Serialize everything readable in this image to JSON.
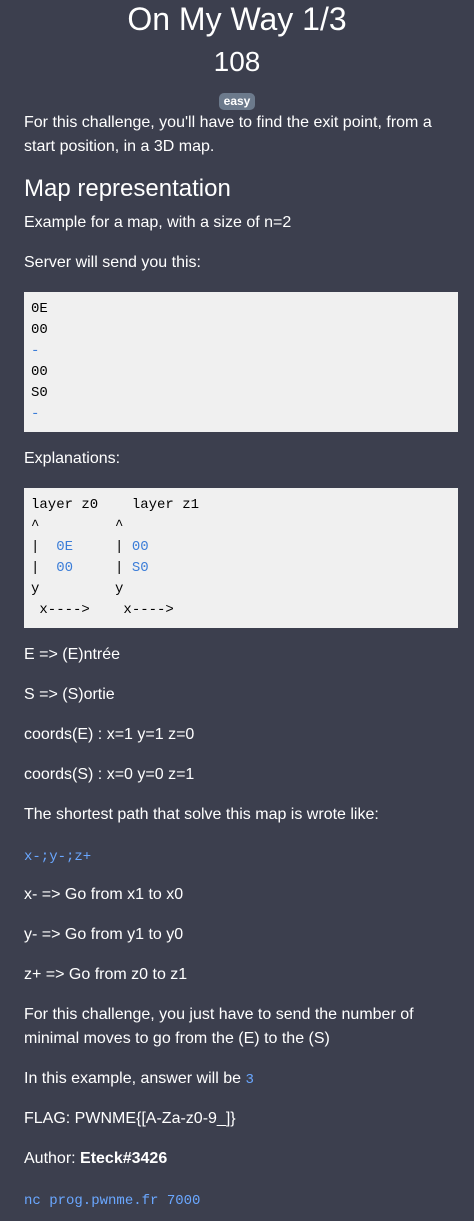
{
  "challenge": {
    "title": "On My Way 1/3",
    "points": "108",
    "difficulty": "easy"
  },
  "content": {
    "intro": "For this challenge, you'll have to find the exit point, from a start position, in a 3D map.",
    "heading": "Map representation",
    "example_line": "Example for a map, with a size of n=2",
    "server_line": "Server will send you this:",
    "server_block": [
      "0E",
      "00",
      "-",
      "00",
      "S0",
      "-"
    ],
    "explanations_label": "Explanations:",
    "explanation_block": {
      "header": "layer z0    layer z1",
      "arrows": "^         ^",
      "row1_a": "|  ",
      "row1_b": "0E",
      "row1_c": "     | ",
      "row1_d": "00",
      "row2_a": "|  ",
      "row2_b": "00",
      "row2_c": "     | ",
      "row2_d": "S0",
      "yline": "y         y",
      "xline": " x---->    x---->"
    },
    "e_def": "E => (E)ntrée",
    "s_def": "S => (S)ortie",
    "coords_e": "coords(E) : x=1 y=1 z=0",
    "coords_s": "coords(S) : x=0 y=0 z=1",
    "path_intro": "The shortest path that solve this map is wrote like:",
    "path_code": "x-;y-;z+",
    "x_move": "x- => Go from x1 to x0",
    "y_move": "y- => Go from y1 to y0",
    "z_move": "z+ => Go from z0 to z1",
    "task": "For this challenge, you just have to send the number of minimal moves to go from the (E) to the (S)",
    "answer_prefix": "In this example, answer will be ",
    "answer_value": "3",
    "flag": "FLAG: PWNME{[A-Za-z0-9_]}",
    "author_prefix": "Author: ",
    "author_name": "Eteck#3426",
    "nc_command": "nc prog.pwnme.fr 7000"
  },
  "colors": {
    "background": "#3c3f4e",
    "code_block_bg": "#f0f0f0",
    "inline_code": "#6aa7ff",
    "badge": "#6c7a8c"
  }
}
